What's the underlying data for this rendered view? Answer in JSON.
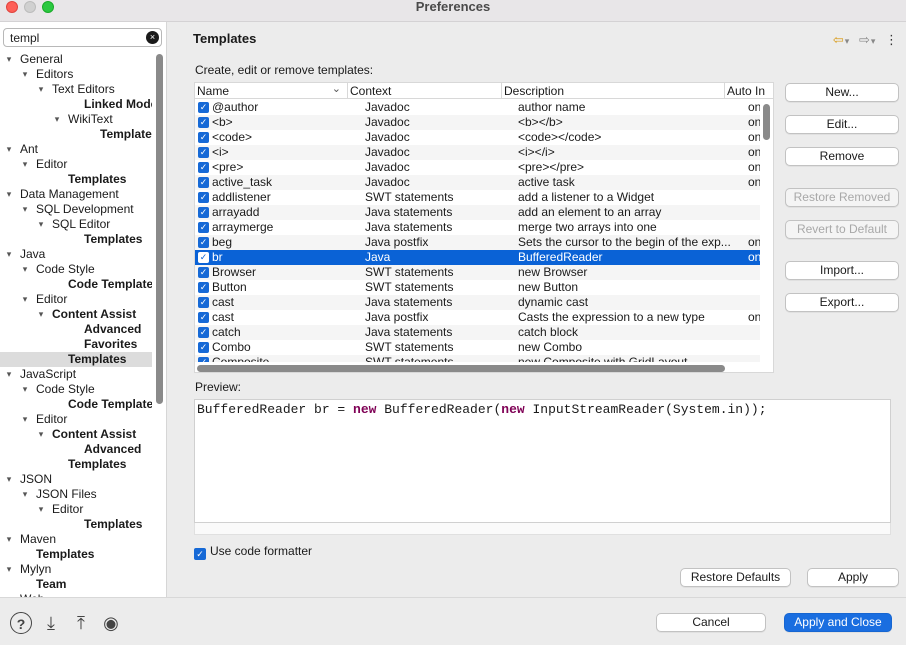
{
  "window": {
    "title": "Preferences"
  },
  "filter": {
    "value": "templ",
    "clear_glyph": "×"
  },
  "tree": [
    {
      "label": "General",
      "depth": 0,
      "arrow": "▾",
      "bold": false
    },
    {
      "label": "Editors",
      "depth": 1,
      "arrow": "▾",
      "bold": false
    },
    {
      "label": "Text Editors",
      "depth": 2,
      "arrow": "▾",
      "bold": false
    },
    {
      "label": "Linked Mode",
      "depth": 4,
      "arrow": "",
      "bold": true
    },
    {
      "label": "WikiText",
      "depth": 3,
      "arrow": "▾",
      "bold": false
    },
    {
      "label": "Templates",
      "depth": 5,
      "arrow": "",
      "bold": true
    },
    {
      "label": "Ant",
      "depth": 0,
      "arrow": "▾",
      "bold": false
    },
    {
      "label": "Editor",
      "depth": 1,
      "arrow": "▾",
      "bold": false
    },
    {
      "label": "Templates",
      "depth": 3,
      "arrow": "",
      "bold": true
    },
    {
      "label": "Data Management",
      "depth": 0,
      "arrow": "▾",
      "bold": false
    },
    {
      "label": "SQL Development",
      "depth": 1,
      "arrow": "▾",
      "bold": false
    },
    {
      "label": "SQL Editor",
      "depth": 2,
      "arrow": "▾",
      "bold": false
    },
    {
      "label": "Templates",
      "depth": 4,
      "arrow": "",
      "bold": true
    },
    {
      "label": "Java",
      "depth": 0,
      "arrow": "▾",
      "bold": false
    },
    {
      "label": "Code Style",
      "depth": 1,
      "arrow": "▾",
      "bold": false
    },
    {
      "label": "Code Templates",
      "depth": 3,
      "arrow": "",
      "bold": true
    },
    {
      "label": "Editor",
      "depth": 1,
      "arrow": "▾",
      "bold": false
    },
    {
      "label": "Content Assist",
      "depth": 2,
      "arrow": "▾",
      "bold": true
    },
    {
      "label": "Advanced",
      "depth": 4,
      "arrow": "",
      "bold": true
    },
    {
      "label": "Favorites",
      "depth": 4,
      "arrow": "",
      "bold": true
    },
    {
      "label": "Templates",
      "depth": 3,
      "arrow": "",
      "bold": true,
      "selected": true
    },
    {
      "label": "JavaScript",
      "depth": 0,
      "arrow": "▾",
      "bold": false
    },
    {
      "label": "Code Style",
      "depth": 1,
      "arrow": "▾",
      "bold": false
    },
    {
      "label": "Code Templates",
      "depth": 3,
      "arrow": "",
      "bold": true
    },
    {
      "label": "Editor",
      "depth": 1,
      "arrow": "▾",
      "bold": false
    },
    {
      "label": "Content Assist",
      "depth": 2,
      "arrow": "▾",
      "bold": true
    },
    {
      "label": "Advanced",
      "depth": 4,
      "arrow": "",
      "bold": true
    },
    {
      "label": "Templates",
      "depth": 3,
      "arrow": "",
      "bold": true
    },
    {
      "label": "JSON",
      "depth": 0,
      "arrow": "▾",
      "bold": false
    },
    {
      "label": "JSON Files",
      "depth": 1,
      "arrow": "▾",
      "bold": false
    },
    {
      "label": "Editor",
      "depth": 2,
      "arrow": "▾",
      "bold": false
    },
    {
      "label": "Templates",
      "depth": 4,
      "arrow": "",
      "bold": true
    },
    {
      "label": "Maven",
      "depth": 0,
      "arrow": "▾",
      "bold": false
    },
    {
      "label": "Templates",
      "depth": 1,
      "arrow": "",
      "bold": true
    },
    {
      "label": "Mylyn",
      "depth": 0,
      "arrow": "▾",
      "bold": false
    },
    {
      "label": "Team",
      "depth": 1,
      "arrow": "",
      "bold": true
    },
    {
      "label": "Web",
      "depth": 0,
      "arrow": "▸",
      "bold": false
    }
  ],
  "page": {
    "title": "Templates",
    "description": "Create, edit or remove templates:",
    "nav": {
      "back": "⇦",
      "back_menu": "▾",
      "forward": "⇨",
      "forward_menu": "▾",
      "more": "⋮"
    }
  },
  "table": {
    "headers": {
      "name": "Name",
      "context": "Context",
      "description": "Description",
      "auto": "Auto In",
      "sort_glyph": "⌄"
    },
    "rows": [
      {
        "name": "@author",
        "context": "Javadoc",
        "description": "author name",
        "auto": "on"
      },
      {
        "name": "<b>",
        "context": "Javadoc",
        "description": "<b></b>",
        "auto": "on"
      },
      {
        "name": "<code>",
        "context": "Javadoc",
        "description": "<code></code>",
        "auto": "on"
      },
      {
        "name": "<i>",
        "context": "Javadoc",
        "description": "<i></i>",
        "auto": "on"
      },
      {
        "name": "<pre>",
        "context": "Javadoc",
        "description": "<pre></pre>",
        "auto": "on"
      },
      {
        "name": "active_task",
        "context": "Javadoc",
        "description": "active task",
        "auto": "on"
      },
      {
        "name": "addlistener",
        "context": "SWT statements",
        "description": "add a listener to a Widget",
        "auto": ""
      },
      {
        "name": "arrayadd",
        "context": "Java statements",
        "description": "add an element to an array",
        "auto": ""
      },
      {
        "name": "arraymerge",
        "context": "Java statements",
        "description": "merge two arrays into one",
        "auto": ""
      },
      {
        "name": "beg",
        "context": "Java postfix",
        "description": "Sets the cursor to the begin of the exp...",
        "auto": "on"
      },
      {
        "name": "br",
        "context": "Java",
        "description": "BufferedReader",
        "auto": "on",
        "selected": true
      },
      {
        "name": "Browser",
        "context": "SWT statements",
        "description": "new Browser",
        "auto": ""
      },
      {
        "name": "Button",
        "context": "SWT statements",
        "description": "new Button",
        "auto": ""
      },
      {
        "name": "cast",
        "context": "Java statements",
        "description": "dynamic cast",
        "auto": ""
      },
      {
        "name": "cast",
        "context": "Java postfix",
        "description": "Casts the expression to a new type",
        "auto": "on"
      },
      {
        "name": "catch",
        "context": "Java statements",
        "description": "catch block",
        "auto": ""
      },
      {
        "name": "Combo",
        "context": "SWT statements",
        "description": "new Combo",
        "auto": ""
      },
      {
        "name": "Composite",
        "context": "SWT statements",
        "description": "new Composite with GridLayout",
        "auto": ""
      }
    ],
    "check_glyph": "✓"
  },
  "side_buttons": {
    "new": "New...",
    "edit": "Edit...",
    "remove": "Remove",
    "restore_removed": "Restore Removed",
    "revert": "Revert to Default",
    "import": "Import...",
    "export": "Export..."
  },
  "preview": {
    "label": "Preview:",
    "code": {
      "p1": "BufferedReader br = ",
      "kw1": "new",
      "p2": " BufferedReader(",
      "kw2": "new",
      "p3": " InputStreamReader(System.in));"
    }
  },
  "formatter": {
    "label": "Use code formatter",
    "checked": true
  },
  "footer_buttons": {
    "restore_defaults": "Restore Defaults",
    "apply": "Apply",
    "cancel": "Cancel",
    "apply_close": "Apply and Close"
  },
  "bottom_icons": {
    "help": "?",
    "import_prefs": "⤓",
    "export_prefs": "⤒",
    "record": "◉"
  }
}
